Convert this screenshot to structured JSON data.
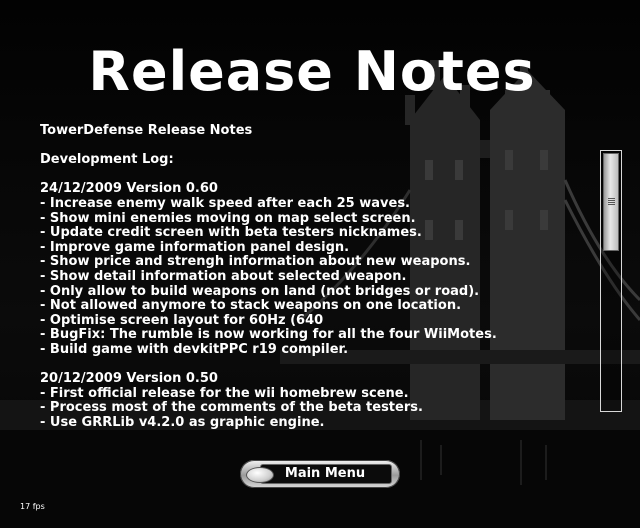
{
  "title": "Release Notes",
  "notes": {
    "app_title": "TowerDefense Release Notes",
    "log_heading": "Development Log:",
    "v060": {
      "heading": "24/12/2009 Version 0.60",
      "items": [
        "- Increase enemy walk speed after each 25 waves.",
        "- Show mini enemies moving on map select screen.",
        "- Update credit screen with beta testers nicknames.",
        "- Improve game information panel design.",
        "- Show price and strengh information about new weapons.",
        "- Show detail information about selected weapon.",
        "- Only allow to build weapons on land (not bridges or road).",
        "- Not allowed anymore to stack weapons on one location.",
        "- Optimise screen layout for 60Hz (640",
        "- BugFix: The rumble is now working for all the four WiiMotes.",
        "- Build game with devkitPPC r19 compiler."
      ]
    },
    "v050": {
      "heading": "20/12/2009 Version 0.50",
      "items": [
        "- First official release for the wii homebrew scene.",
        "- Process most of the comments of the beta testers.",
        "- Use GRRLib v4.2.0 as graphic engine."
      ]
    }
  },
  "main_menu_label": "Main Menu",
  "fps_label": "17 fps",
  "scroll_position_fraction": 0.0
}
